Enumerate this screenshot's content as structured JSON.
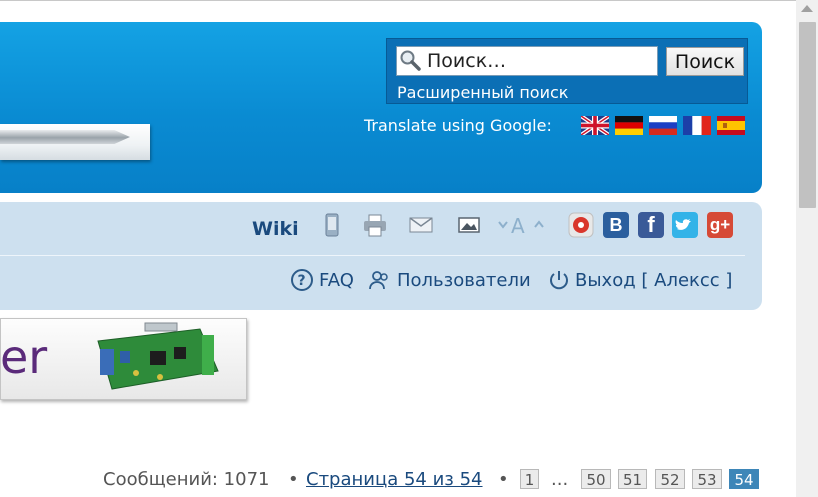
{
  "header": {
    "search": {
      "placeholder": "Поиск…",
      "button_label": "Поиск",
      "advanced_link": "Расширенный поиск"
    },
    "translate": {
      "label": "Translate using Google:",
      "flags": [
        "english-flag",
        "german-flag",
        "russian-flag",
        "french-flag",
        "spanish-flag"
      ]
    }
  },
  "toolbar": {
    "wiki_label": "Wiki",
    "icons": [
      "mobile-icon",
      "print-icon",
      "email-icon",
      "image-icon",
      "font-size-icon",
      "share-icon",
      "vkontakte-icon",
      "facebook-icon",
      "twitter-icon",
      "google-plus-icon"
    ],
    "social": {
      "vk": "B",
      "facebook": "f",
      "gplus": "g+"
    }
  },
  "nav": {
    "faq": "FAQ",
    "users": "Пользователи",
    "logout": "Выход [ Алексс ]"
  },
  "banner": {
    "text": "er"
  },
  "pagination": {
    "message_count": "Сообщений: 1071",
    "bullet": "•",
    "page_info": "Страница 54 из 54",
    "pages": [
      "1",
      "50",
      "51",
      "52",
      "53",
      "54"
    ],
    "ellipsis": "...",
    "current": "54"
  },
  "colors": {
    "header_blue": "#0a8bd2",
    "nav_bg": "#cde0ef",
    "link": "#1a4a7e",
    "active_page": "#3d86b8"
  }
}
